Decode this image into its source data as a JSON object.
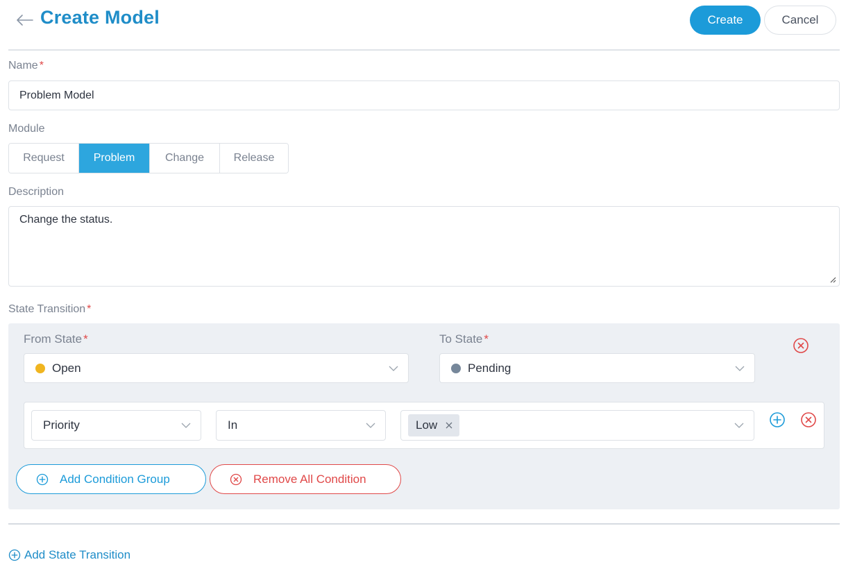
{
  "header": {
    "title": "Create Model",
    "create_label": "Create",
    "cancel_label": "Cancel"
  },
  "form": {
    "name": {
      "label": "Name",
      "required_mark": "*",
      "value": "Problem Model"
    },
    "module": {
      "label": "Module",
      "options": [
        "Request",
        "Problem",
        "Change",
        "Release"
      ],
      "selected": "Problem"
    },
    "description": {
      "label": "Description",
      "value": "Change the status."
    },
    "state_transition": {
      "label": "State Transition",
      "required_mark": "*",
      "from_state": {
        "label": "From State",
        "value": "Open",
        "color": "#f0b520"
      },
      "to_state": {
        "label": "To State",
        "value": "Pending",
        "color": "#76879a"
      },
      "condition": {
        "field": "Priority",
        "operator": "In",
        "values": [
          "Low"
        ]
      },
      "add_condition_group_label": "Add Condition Group",
      "remove_all_condition_label": "Remove All Condition"
    },
    "add_state_transition_label": "Add State Transition"
  },
  "colors": {
    "accent": "#1f8dc8",
    "primary_button": "#1c9bd9",
    "active_segment": "#2da6de",
    "danger": "#e04848",
    "panel_bg": "#edf0f4"
  },
  "icons": {
    "back": "arrow-left-icon",
    "remove": "circle-x-icon",
    "add": "circle-plus-icon",
    "dropdown": "chevron-down-icon",
    "tag_remove": "close-icon"
  }
}
